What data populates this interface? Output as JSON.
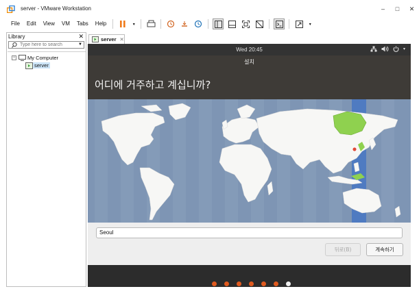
{
  "window": {
    "title": "server - VMware Workstation",
    "minimize": "–",
    "maximize": "□",
    "close": "✕"
  },
  "menu": {
    "items": [
      "File",
      "Edit",
      "View",
      "VM",
      "Tabs",
      "Help"
    ]
  },
  "toolbar": {
    "icons": [
      "pause-icon",
      "dropdown-icon",
      "send-keys-icon",
      "snapshot-icon",
      "revert-icon",
      "snapshot-manager-icon",
      "sidebar-icon",
      "console-icon",
      "fullscreen-icon",
      "unity-icon",
      "terminal-icon",
      "stretch-icon"
    ]
  },
  "library": {
    "title": "Library",
    "close": "✕",
    "search_placeholder": "Type here to search",
    "tree": {
      "root": "My Computer",
      "child": "server"
    }
  },
  "tab": {
    "label": "server",
    "close": "✕"
  },
  "guest": {
    "clock": "Wed 20:45",
    "header_title": "설치",
    "question": "어디에 거주하고 계십니까?",
    "location_value": "Seoul",
    "back_button": "뒤로(B)",
    "next_button": "계속하기",
    "step_count": 7,
    "current_step": 7,
    "colors": {
      "accent": "#e05a1f",
      "map_ocean": "#7e95b4",
      "timezone_band": "#4f7bc1",
      "selected_country": "#8fd14f"
    }
  }
}
